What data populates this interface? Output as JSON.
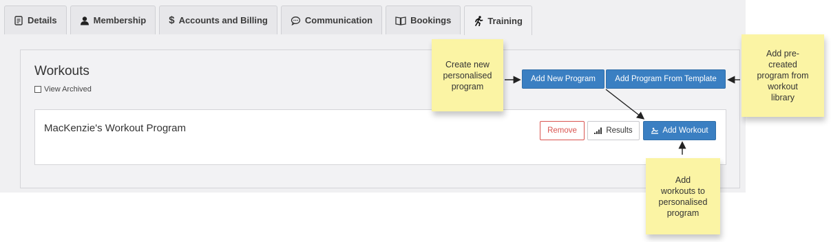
{
  "tabs": [
    {
      "label": "Details",
      "icon": "document-icon"
    },
    {
      "label": "Membership",
      "icon": "user-icon"
    },
    {
      "label": "Accounts and Billing",
      "icon": "dollar-icon"
    },
    {
      "label": "Communication",
      "icon": "speech-bubble-icon"
    },
    {
      "label": "Bookings",
      "icon": "book-icon"
    },
    {
      "label": "Training",
      "icon": "running-man-icon",
      "active": true
    }
  ],
  "main": {
    "title": "Workouts",
    "view_archived_label": "View Archived",
    "add_new_program_label": "Add New Program",
    "add_from_template_label": "Add Program From Template"
  },
  "program": {
    "name": "MacKenzie's Workout Program",
    "remove_label": "Remove",
    "results_label": "Results",
    "add_workout_label": "Add Workout"
  },
  "notes": {
    "create_new": "Create new\npersonalised\nprogram",
    "add_precreated": "Add pre-\ncreated\nprogram from\nworkout\nlibrary",
    "add_workouts": "Add\nworkouts to\npersonalised\nprogram"
  },
  "colors": {
    "primary": "#3a7fc2",
    "danger": "#d9534f",
    "note": "#fbf4a4"
  }
}
